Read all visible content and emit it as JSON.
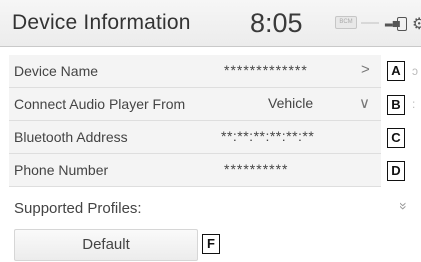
{
  "header": {
    "title": "Device Information",
    "time": "8:05",
    "badge_text": "BCM"
  },
  "rows": [
    {
      "label": "Device Name",
      "value": "*************",
      "chevron": ">",
      "marker": "A"
    },
    {
      "label": "Connect Audio Player From",
      "value": "Vehicle",
      "chevron": "∨",
      "marker": "B"
    },
    {
      "label": "Bluetooth Address",
      "value": "**:**:**:**:**:**",
      "marker": "C"
    },
    {
      "label": "Phone Number",
      "value": "**********",
      "marker": "D"
    }
  ],
  "profiles": {
    "label": "Supported Profiles:",
    "expand_icon": "»"
  },
  "default_button": {
    "label": "Default",
    "marker": "F"
  },
  "colors": {
    "row_bg": "#f4f4f4",
    "header_bg": "#ececec",
    "text": "#444444"
  }
}
